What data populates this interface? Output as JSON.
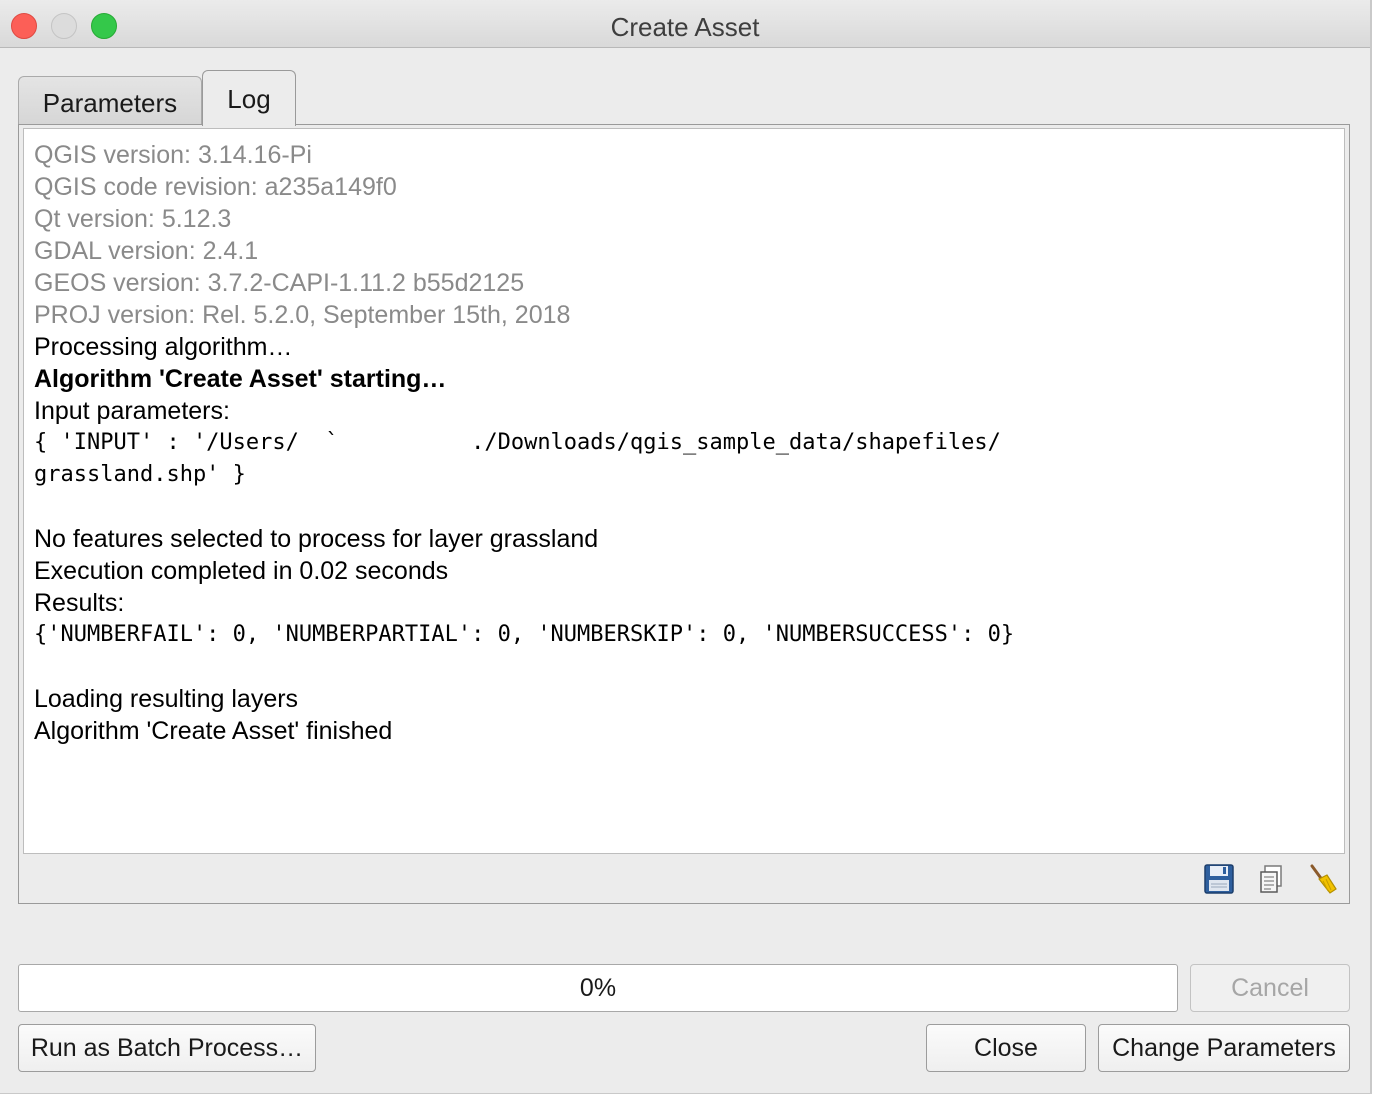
{
  "window": {
    "title": "Create Asset"
  },
  "tabs": [
    {
      "label": "Parameters",
      "active": false
    },
    {
      "label": "Log",
      "active": true
    }
  ],
  "log": {
    "qgis_version": "QGIS version: 3.14.16-Pi",
    "qgis_revision": "QGIS code revision: a235a149f0",
    "qt_version": "Qt version: 5.12.3",
    "gdal_version": "GDAL version: 2.4.1",
    "geos_version": "GEOS version: 3.7.2-CAPI-1.11.2 b55d2125",
    "proj_version": "PROJ version: Rel. 5.2.0, September 15th, 2018",
    "processing": "Processing algorithm…",
    "starting": "Algorithm 'Create Asset' starting…",
    "input_params_label": "Input parameters:",
    "input_params_line1": "{ 'INPUT' : '/Users/  `          ./Downloads/qgis_sample_data/shapefiles/",
    "input_params_line2": "grassland.shp' }",
    "no_features": "No features selected to process for layer grassland",
    "execution": "Execution completed in 0.02 seconds",
    "results_label": "Results:",
    "results": "{'NUMBERFAIL': 0, 'NUMBERPARTIAL': 0, 'NUMBERSKIP': 0, 'NUMBERSUCCESS': 0}",
    "loading": "Loading resulting layers",
    "finished": "Algorithm 'Create Asset' finished"
  },
  "log_tools": {
    "icons": [
      "save-icon",
      "copy-icon",
      "clear-icon"
    ]
  },
  "progress": {
    "value": 0,
    "text": "0%"
  },
  "buttons": {
    "cancel": "Cancel",
    "batch": "Run as Batch Process…",
    "close": "Close",
    "change_parameters": "Change Parameters"
  }
}
